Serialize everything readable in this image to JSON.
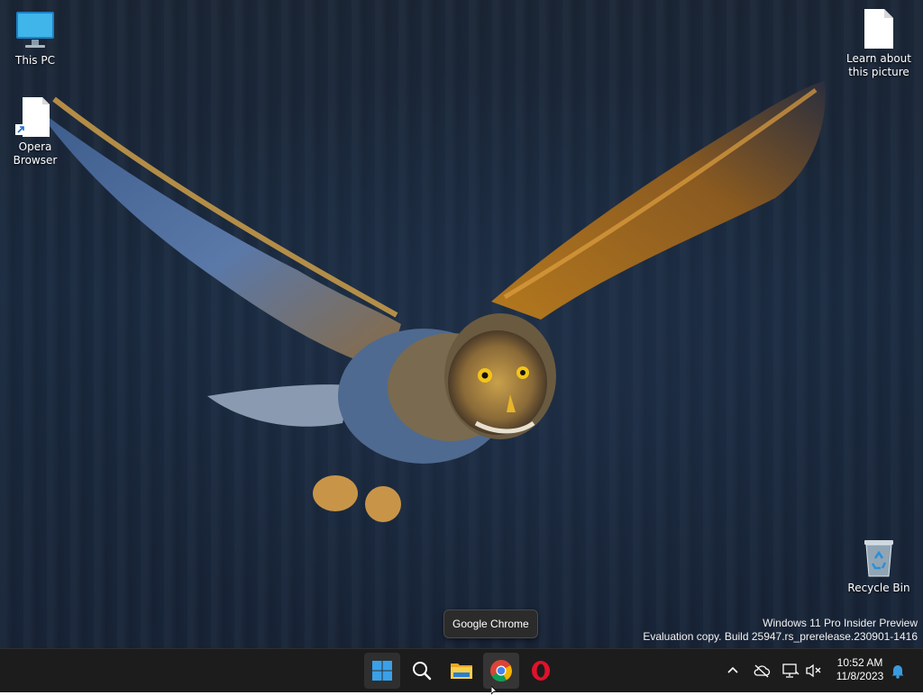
{
  "desktop_icons": [
    {
      "id": "this-pc",
      "label": "This PC",
      "icon": "monitor-icon"
    },
    {
      "id": "opera",
      "label": "Opera Browser",
      "icon": "file-shortcut-icon"
    },
    {
      "id": "learn",
      "label": "Learn about this picture",
      "icon": "file-icon"
    },
    {
      "id": "recycle",
      "label": "Recycle Bin",
      "icon": "recycle-bin-icon"
    }
  ],
  "watermark": {
    "line1": "Windows 11 Pro Insider Preview",
    "line2": "Evaluation copy. Build 25947.rs_prerelease.230901-1416"
  },
  "tooltip": {
    "text": "Google Chrome"
  },
  "taskbar": {
    "apps": [
      {
        "name": "start",
        "icon": "windows-start-icon"
      },
      {
        "name": "search",
        "icon": "search-icon"
      },
      {
        "name": "file-explorer",
        "icon": "folder-icon"
      },
      {
        "name": "google-chrome",
        "icon": "chrome-icon"
      },
      {
        "name": "opera",
        "icon": "opera-icon"
      }
    ],
    "tray": {
      "icons": [
        "chevron-up-icon",
        "cloud-off-icon",
        "network-icon",
        "speaker-muted-icon"
      ],
      "time": "10:52 AM",
      "date": "11/8/2023",
      "notification_icon": "bell-icon"
    }
  },
  "colors": {
    "taskbar_bg": "#1c1c1c",
    "accent_blue": "#3a9bdc",
    "owl_gold": "#c98a2e"
  }
}
